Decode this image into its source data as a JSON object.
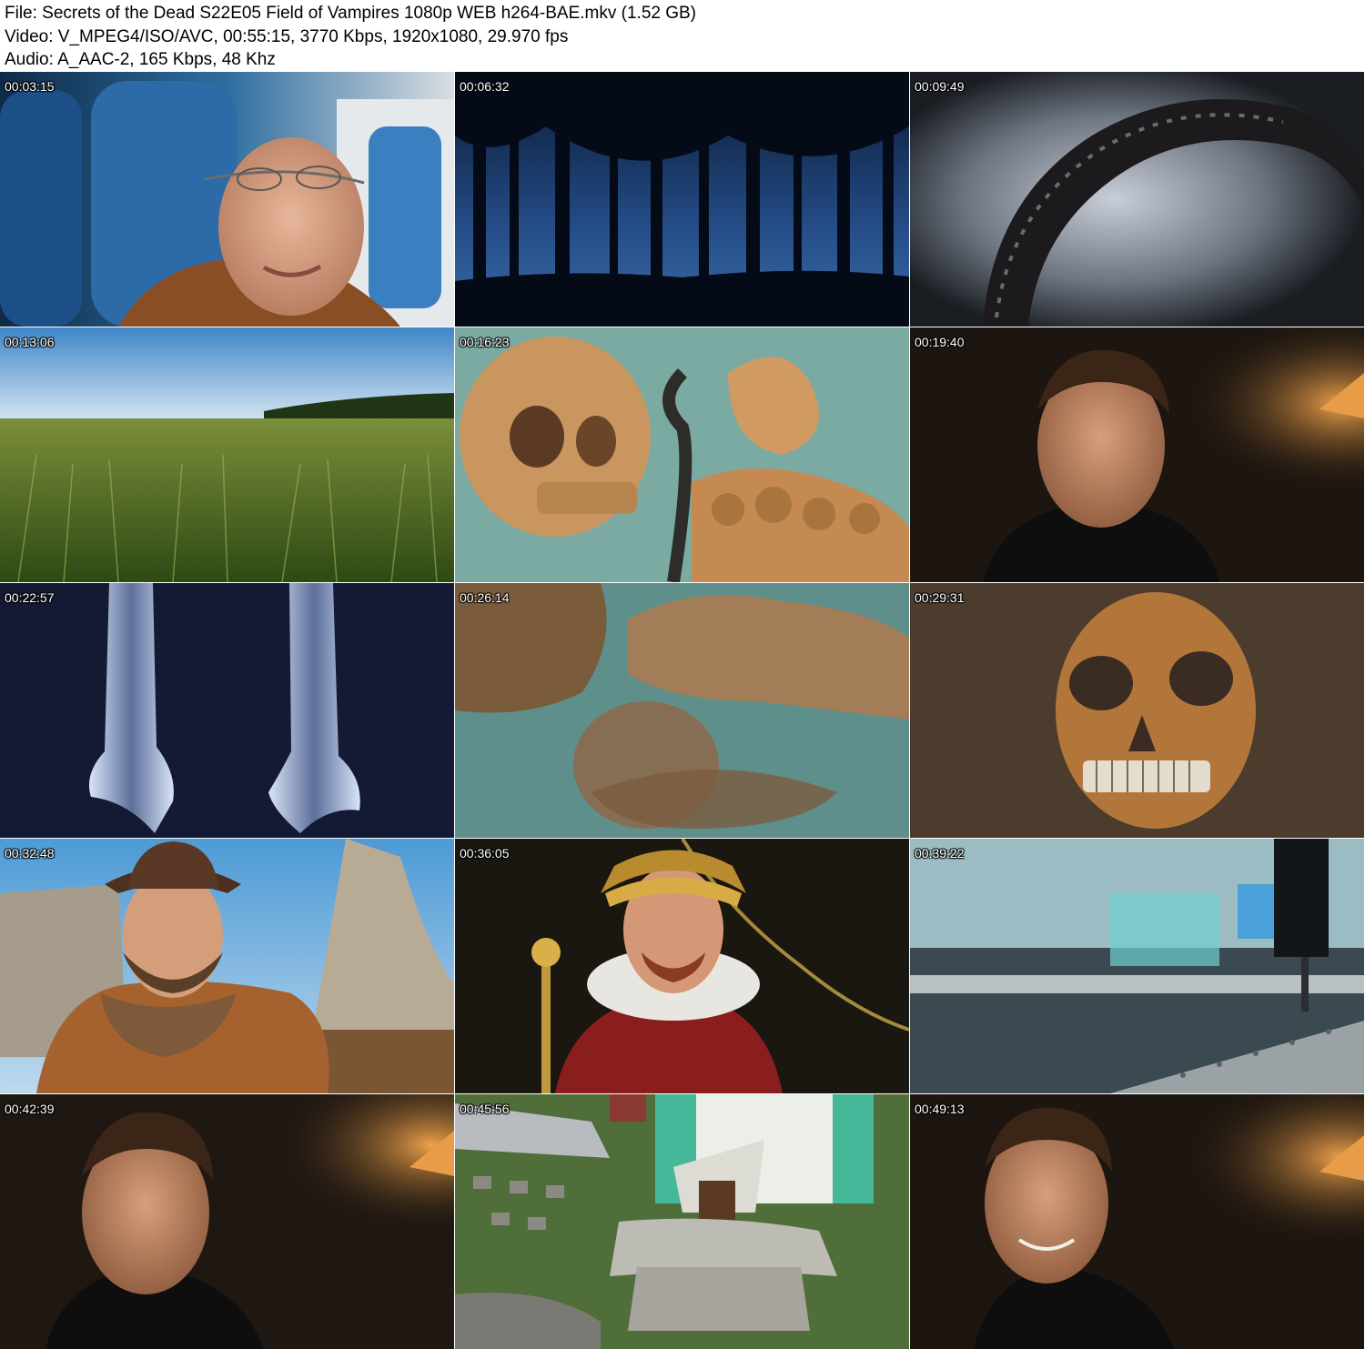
{
  "header": {
    "file_line": "File: Secrets of the Dead S22E05 Field of Vampires 1080p WEB h264-BAE.mkv (1.52 GB)",
    "video_line": "Video: V_MPEG4/ISO/AVC, 00:55:15, 3770 Kbps, 1920x1080, 29.970 fps",
    "audio_line": "Audio: A_AAC-2, 165 Kbps, 48 Khz"
  },
  "thumbnails": [
    {
      "timestamp": "00:03:15",
      "scene": "man-on-train"
    },
    {
      "timestamp": "00:06:32",
      "scene": "forest-silhouette"
    },
    {
      "timestamp": "00:09:49",
      "scene": "iron-sickle"
    },
    {
      "timestamp": "00:13:06",
      "scene": "wheat-field"
    },
    {
      "timestamp": "00:16:23",
      "scene": "skull-bones"
    },
    {
      "timestamp": "00:19:40",
      "scene": "interview-man"
    },
    {
      "timestamp": "00:22:57",
      "scene": "xray-bones"
    },
    {
      "timestamp": "00:26:14",
      "scene": "blurred-bones"
    },
    {
      "timestamp": "00:29:31",
      "scene": "buried-skull"
    },
    {
      "timestamp": "00:32:48",
      "scene": "man-with-hat"
    },
    {
      "timestamp": "00:36:05",
      "scene": "emperor-portrait"
    },
    {
      "timestamp": "00:39:22",
      "scene": "laboratory"
    },
    {
      "timestamp": "00:42:39",
      "scene": "interview-man"
    },
    {
      "timestamp": "00:45:56",
      "scene": "church-aerial"
    },
    {
      "timestamp": "00:49:13",
      "scene": "interview-man"
    }
  ]
}
